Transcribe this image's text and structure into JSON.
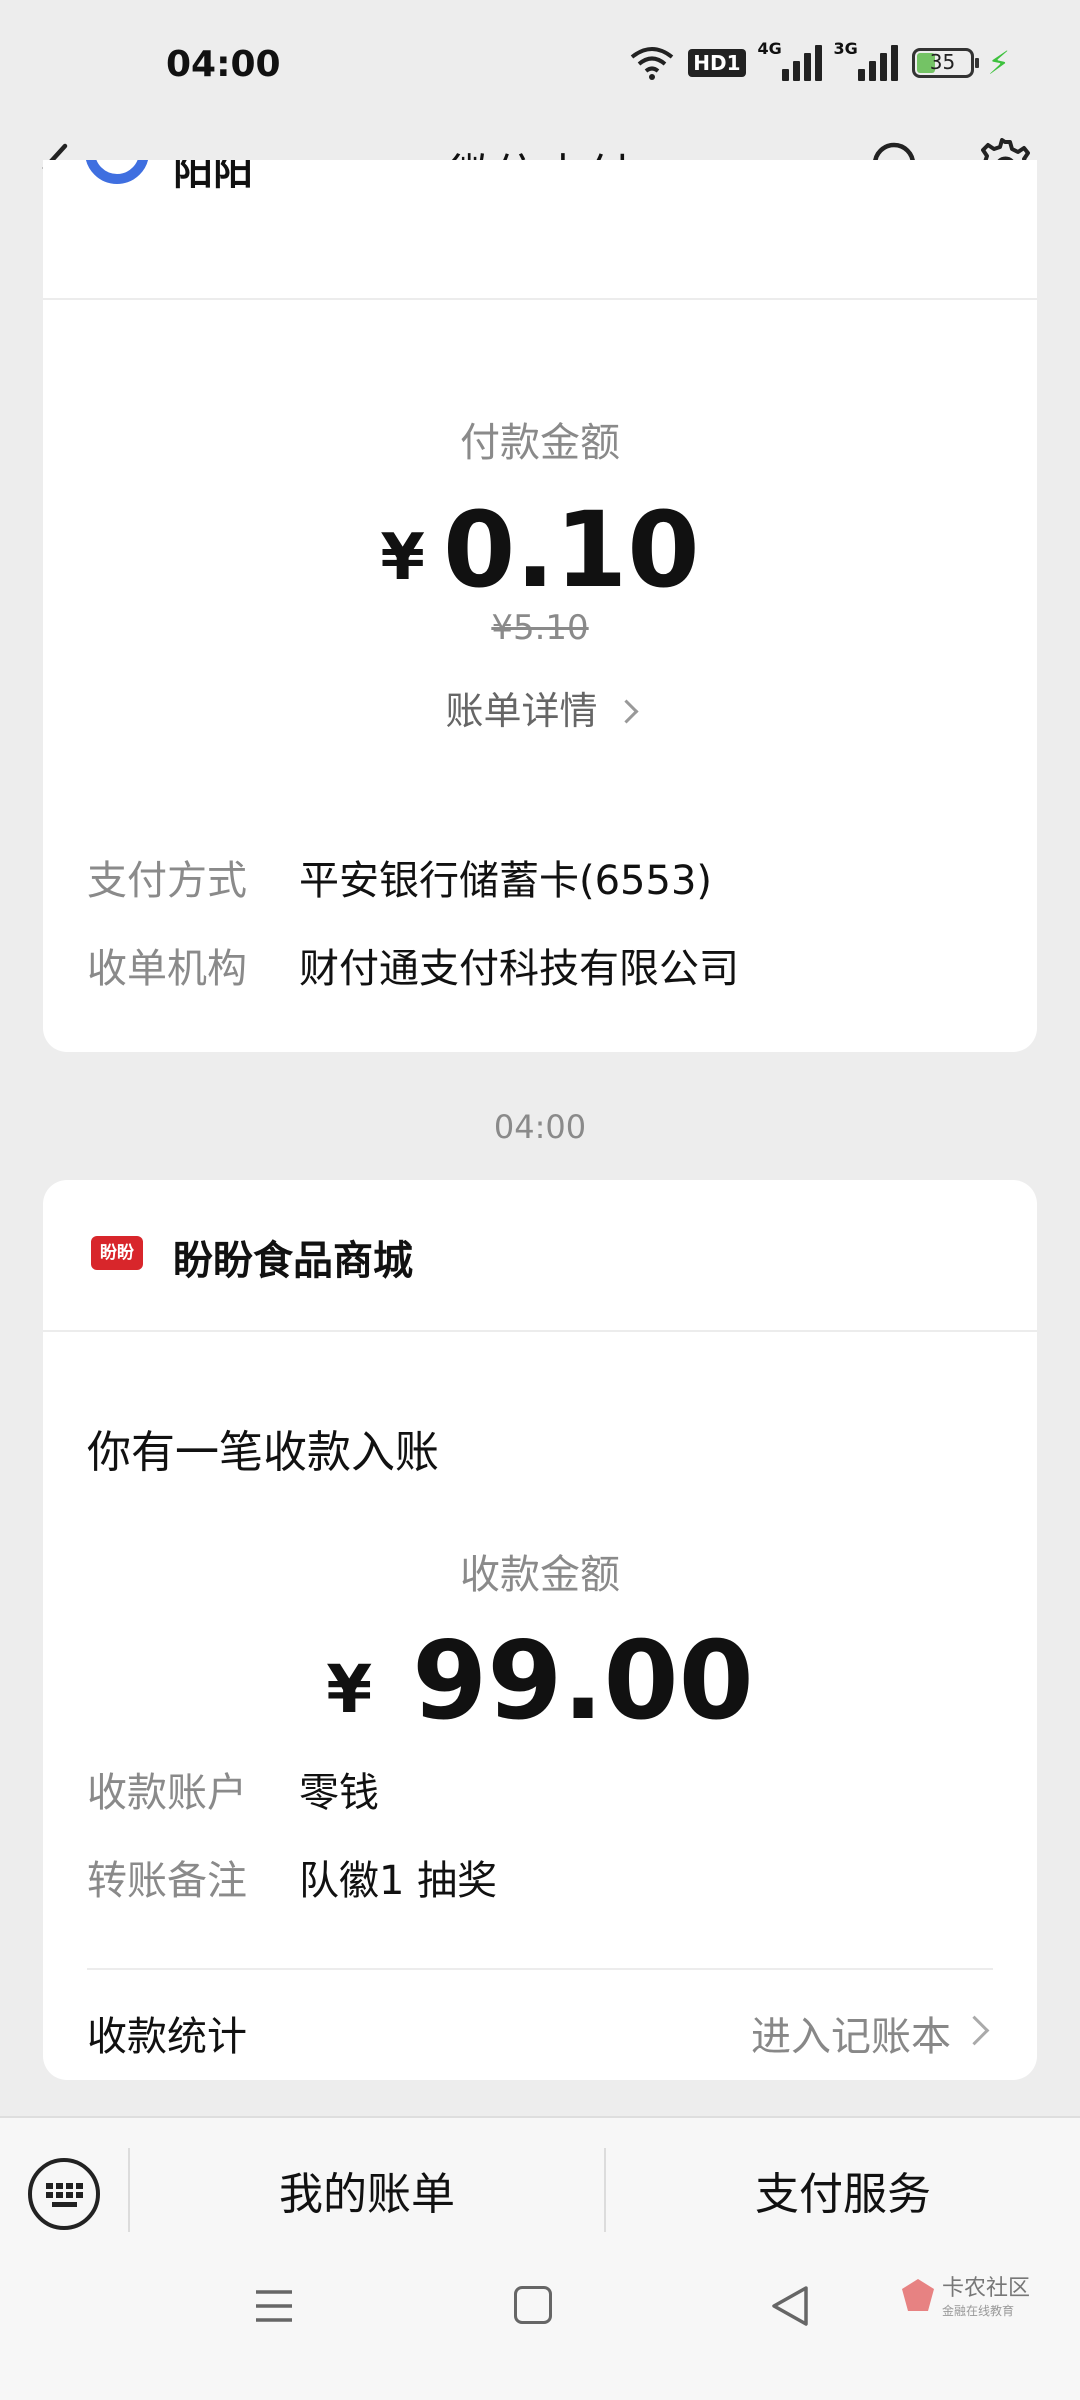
{
  "status": {
    "time": "04:00",
    "battery": "35",
    "hd": "HD1",
    "net1": "4G",
    "net2": "3G"
  },
  "nav": {
    "title": "微信支付"
  },
  "card1": {
    "merchant_partial": "阳阳",
    "amount_label": "付款金额",
    "currency": "¥",
    "amount": "0.10",
    "original_amount": "¥5.10",
    "detail_link": "账单详情",
    "rows": [
      {
        "label": "支付方式",
        "value": "平安银行储蓄卡(6553)"
      },
      {
        "label": "收单机构",
        "value": "财付通支付科技有限公司"
      }
    ]
  },
  "timestamp": "04:00",
  "card2": {
    "merchant": "盼盼食品商城",
    "logo_text": "盼盼",
    "heading": "你有一笔收款入账",
    "amount_label": "收款金额",
    "currency": "¥",
    "amount": "99.00",
    "rows": [
      {
        "label": "收款账户",
        "value": "零钱"
      },
      {
        "label": "转账备注",
        "value": "队徽1 抽奖"
      }
    ],
    "stats_label": "收款统计",
    "stats_link": "进入记账本"
  },
  "bottom": {
    "tab1": "我的账单",
    "tab2": "支付服务"
  },
  "watermark": {
    "main": "卡农社区",
    "sub": "金融在线教育"
  }
}
